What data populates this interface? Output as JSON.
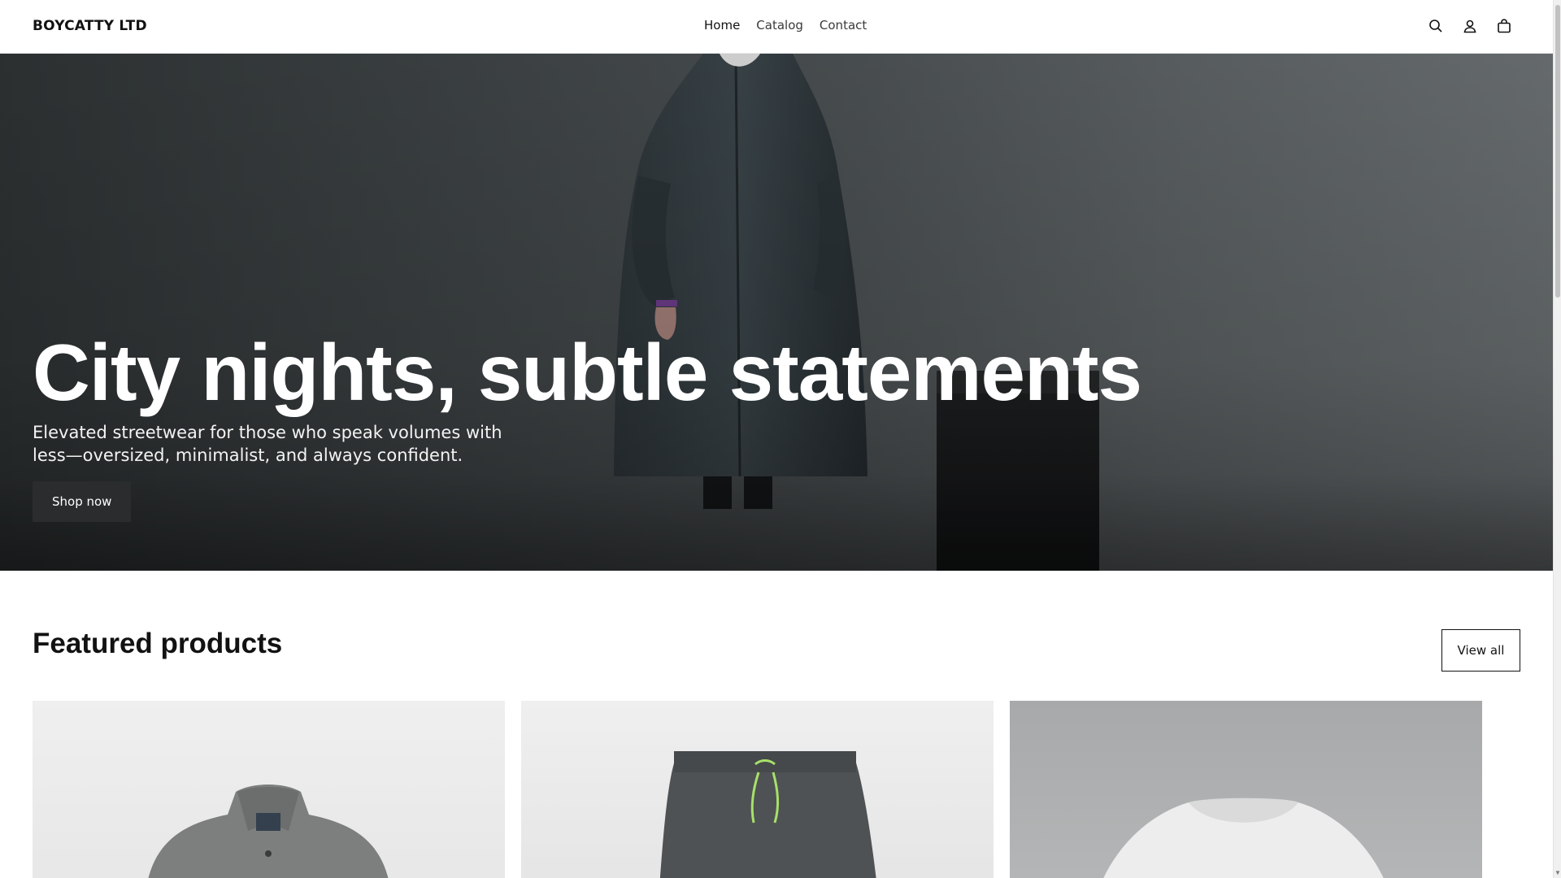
{
  "header": {
    "logo": "BOYCATTY LTD",
    "nav": [
      {
        "label": "Home",
        "active": true
      },
      {
        "label": "Catalog",
        "active": false
      },
      {
        "label": "Contact",
        "active": false
      }
    ],
    "icons": [
      "search-icon",
      "account-icon",
      "cart-icon"
    ]
  },
  "hero": {
    "title": "City nights, subtle statements",
    "subtitle": "Elevated streetwear for those who speak volumes with less—oversized, minimalist, and always confident.",
    "button_label": "Shop now"
  },
  "featured": {
    "title": "Featured products",
    "view_all_label": "View all",
    "products": [
      {
        "image": "grey-jacket"
      },
      {
        "image": "charcoal-shorts"
      },
      {
        "image": "white-tshirt"
      }
    ]
  },
  "colors": {
    "text": "#121212",
    "hero_button": "#2a2c2d",
    "background": "#ffffff"
  }
}
